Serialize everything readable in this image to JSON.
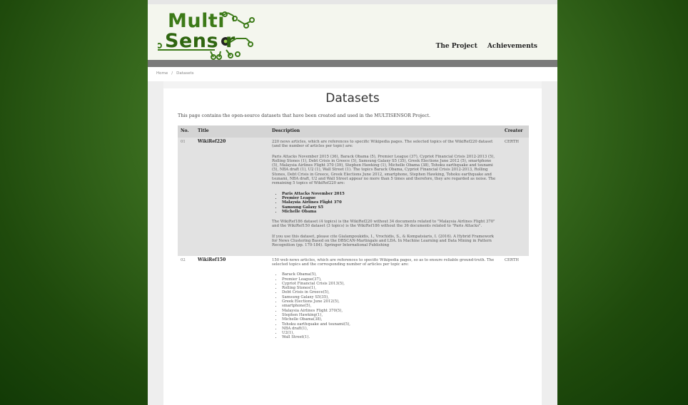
{
  "header": {
    "logo_line1": "Multi",
    "logo_line2": "Sens r",
    "nav": [
      "The Project",
      "Achievements"
    ]
  },
  "breadcrumb": {
    "home": "Home",
    "separator": "/",
    "current": "Datasets"
  },
  "page_title": "Datasets",
  "intro": "This page contains the open-source datasets that have been created and used in the MULTISENSOR Project.",
  "table": {
    "headers": [
      "No.",
      "Title",
      "Description",
      "Creator"
    ],
    "rows": [
      {
        "no": "01",
        "title": "WikiRef220",
        "creator": "CERTH",
        "p1": "220 news articles, which are references to specific Wikipedia pages. The selected topics of the WikiRef220 dataset (and the number of articles per topic) are:",
        "p2": "Paris Attacks November 2015 (36), Barack Obama (5), Premier League (37), Cypriot Financial Crisis 2012-2013 (5), Rolling Stones (1), Debt Crisis in Greece (5), Samsung Galaxy S5 (35), Greek Elections June 2012 (5), smartphone (5), Malaysia Airlines Flight 370 (39), Stephen Hawking (1), Michelle Obama (38), Tohoku earthquake and tsunami (5), NBA draft (1), U2 (1), Wall Street (1). The topics Barack Obama, Cypriot Financial Crisis 2012-2013, Rolling Stones, Debt Crisis in Greece, Greek Elections June 2012, smartphone, Stephen Hawking, Tohoku earthquake and tsunami, NBA draft, U2 and Wall Street appear no more than 5 times and therefore, they are regarded as noise. The remaining 5 topics of WikiRef220 are:",
        "list": [
          "Paris Attacks November 2015",
          "Premier League",
          "Malaysia Airlines Flight 370",
          "Samsung Galaxy S5",
          "Michelle Obama"
        ],
        "p3": "The WikiRef186 dataset (4 topics) is the WikiRef220 without 34 documents related to \"Malaysia Airlines Flight 370\" and the WikiRef150 dataset (3 topics) is the WikiRef186 without the 36 documents related to \"Paris Attacks\".",
        "p4": "If you use this dataset, please cite Gialampoukidis, I., Vrochidis, S., & Kompatsiaris, I. (2016). A Hybrid Framework for News Clustering Based on the DBSCAN-Martingale and LDA. In Machine Learning and Data Mining in Pattern Recognition (pp. 170-184). Springer International Publishing"
      },
      {
        "no": "02",
        "title": "WikiRef150",
        "creator": "CERTH",
        "p1": "150 web news articles, which are references to specific Wikipedia pages, so as to ensure reliable ground-truth. The selected topics and the corresponding number of articles per topic are:",
        "list": [
          "Barack Obama(5),",
          "Premier League(37),",
          "Cypriot Financial Crisis 2013(5),",
          "Rolling Stones(1),",
          "Debt Crisis in Greece(5),",
          "Samsung Galaxy S5(35),",
          "Greek Elections June 2012(5),",
          "smartphone(5),",
          "Malaysia Airlines Flight 370(5),",
          "Stephen Hawking(1),",
          "Michelle Obama(38),",
          "Tohoku earthquake and tsunami(5),",
          "NBA draft(1),",
          "U2(1),",
          "Wall Street(1)."
        ]
      }
    ]
  }
}
